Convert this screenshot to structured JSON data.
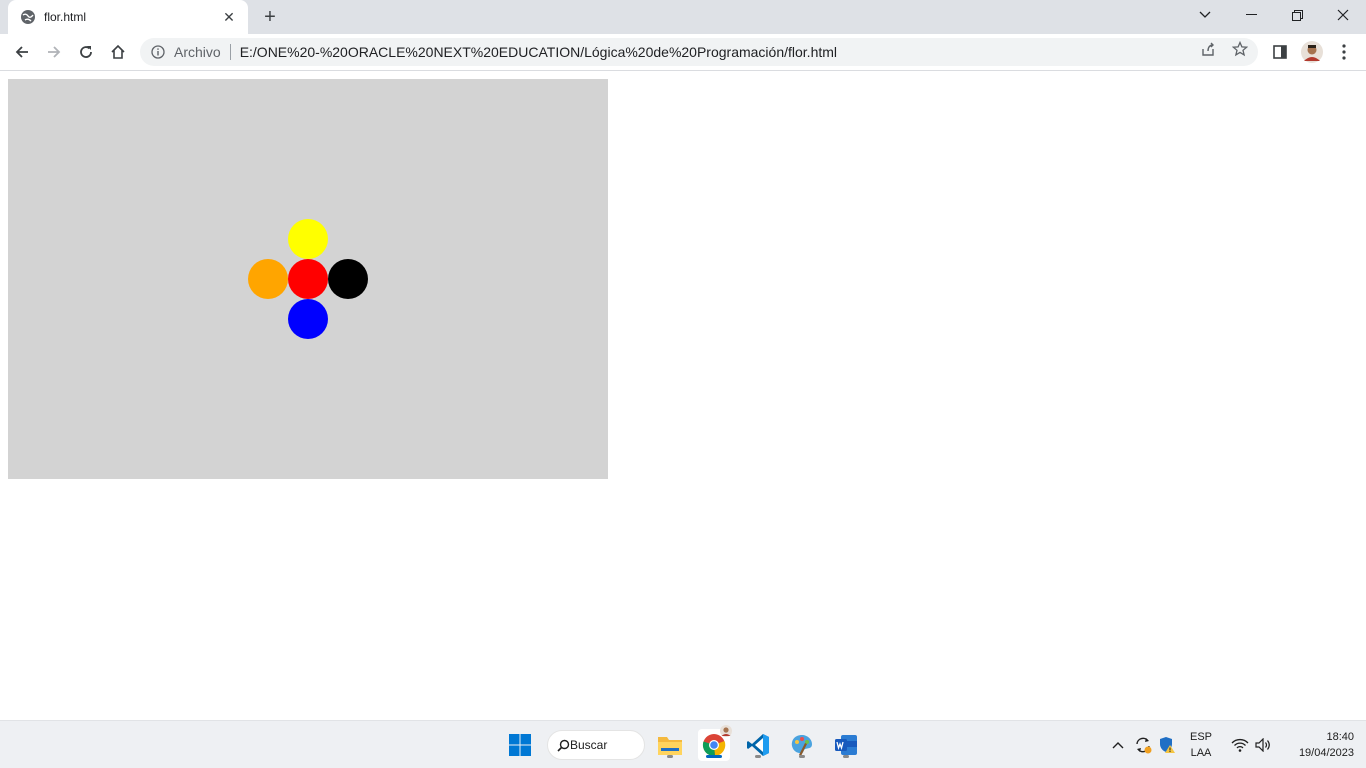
{
  "browser": {
    "tab": {
      "title": "flor.html",
      "close": "✕"
    },
    "new_tab": "+",
    "window_controls": {
      "dropdown": "⌄",
      "minimize": "—",
      "restore": "❐",
      "close": "✕"
    },
    "address": {
      "scheme_label": "Archivo",
      "url": "E:/ONE%20-%20ORACLE%20NEXT%20EDUCATION/Lógica%20de%20Programación/flor.html"
    }
  },
  "page": {
    "canvas_color": "#d3d3d3",
    "petal_colors": {
      "top": "#ffff00",
      "left": "#ffa500",
      "center": "#ff0000",
      "right": "#000000",
      "bottom": "#0000ff"
    }
  },
  "taskbar": {
    "search_label": "Buscar",
    "language": {
      "line1": "ESP",
      "line2": "LAA"
    },
    "clock": {
      "time": "18:40",
      "date": "19/04/2023"
    }
  }
}
